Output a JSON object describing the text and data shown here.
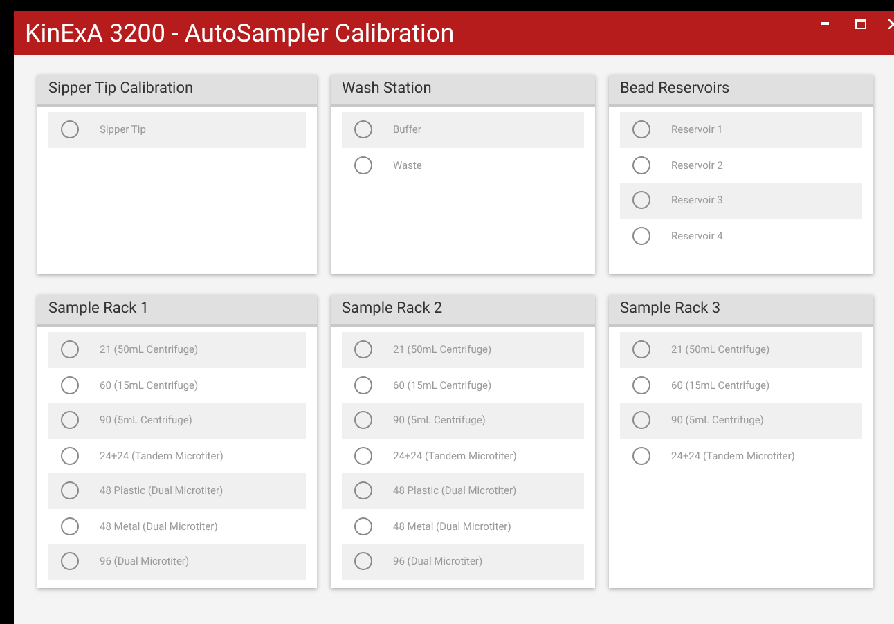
{
  "window": {
    "title": "KinExA 3200 - AutoSampler Calibration"
  },
  "panels": [
    {
      "title": "Sipper Tip Calibration",
      "options": [
        {
          "label": "Sipper Tip",
          "selected": false
        }
      ]
    },
    {
      "title": "Wash Station",
      "options": [
        {
          "label": "Buffer",
          "selected": false
        },
        {
          "label": "Waste",
          "selected": false
        }
      ]
    },
    {
      "title": "Bead Reservoirs",
      "options": [
        {
          "label": "Reservoir 1",
          "selected": false
        },
        {
          "label": "Reservoir 2",
          "selected": false
        },
        {
          "label": "Reservoir 3",
          "selected": false
        },
        {
          "label": "Reservoir 4",
          "selected": false
        }
      ]
    },
    {
      "title": "Sample Rack 1",
      "options": [
        {
          "label": "21 (50mL Centrifuge)",
          "selected": false
        },
        {
          "label": "60 (15mL Centrifuge)",
          "selected": false
        },
        {
          "label": "90 (5mL Centrifuge)",
          "selected": false
        },
        {
          "label": "24+24 (Tandem Microtiter)",
          "selected": false
        },
        {
          "label": "48 Plastic (Dual Microtiter)",
          "selected": false
        },
        {
          "label": "48 Metal (Dual Microtiter)",
          "selected": false
        },
        {
          "label": "96 (Dual Microtiter)",
          "selected": false
        }
      ]
    },
    {
      "title": "Sample Rack 2",
      "options": [
        {
          "label": "21 (50mL Centrifuge)",
          "selected": false
        },
        {
          "label": "60 (15mL Centrifuge)",
          "selected": false
        },
        {
          "label": "90 (5mL Centrifuge)",
          "selected": false
        },
        {
          "label": "24+24 (Tandem Microtiter)",
          "selected": false
        },
        {
          "label": "48 Plastic (Dual Microtiter)",
          "selected": false
        },
        {
          "label": "48 Metal (Dual Microtiter)",
          "selected": false
        },
        {
          "label": "96 (Dual Microtiter)",
          "selected": false
        }
      ]
    },
    {
      "title": "Sample Rack 3",
      "options": [
        {
          "label": "21 (50mL Centrifuge)",
          "selected": false
        },
        {
          "label": "60 (15mL Centrifuge)",
          "selected": false
        },
        {
          "label": "90 (5mL Centrifuge)",
          "selected": false
        },
        {
          "label": "24+24 (Tandem Microtiter)",
          "selected": false
        }
      ]
    }
  ]
}
